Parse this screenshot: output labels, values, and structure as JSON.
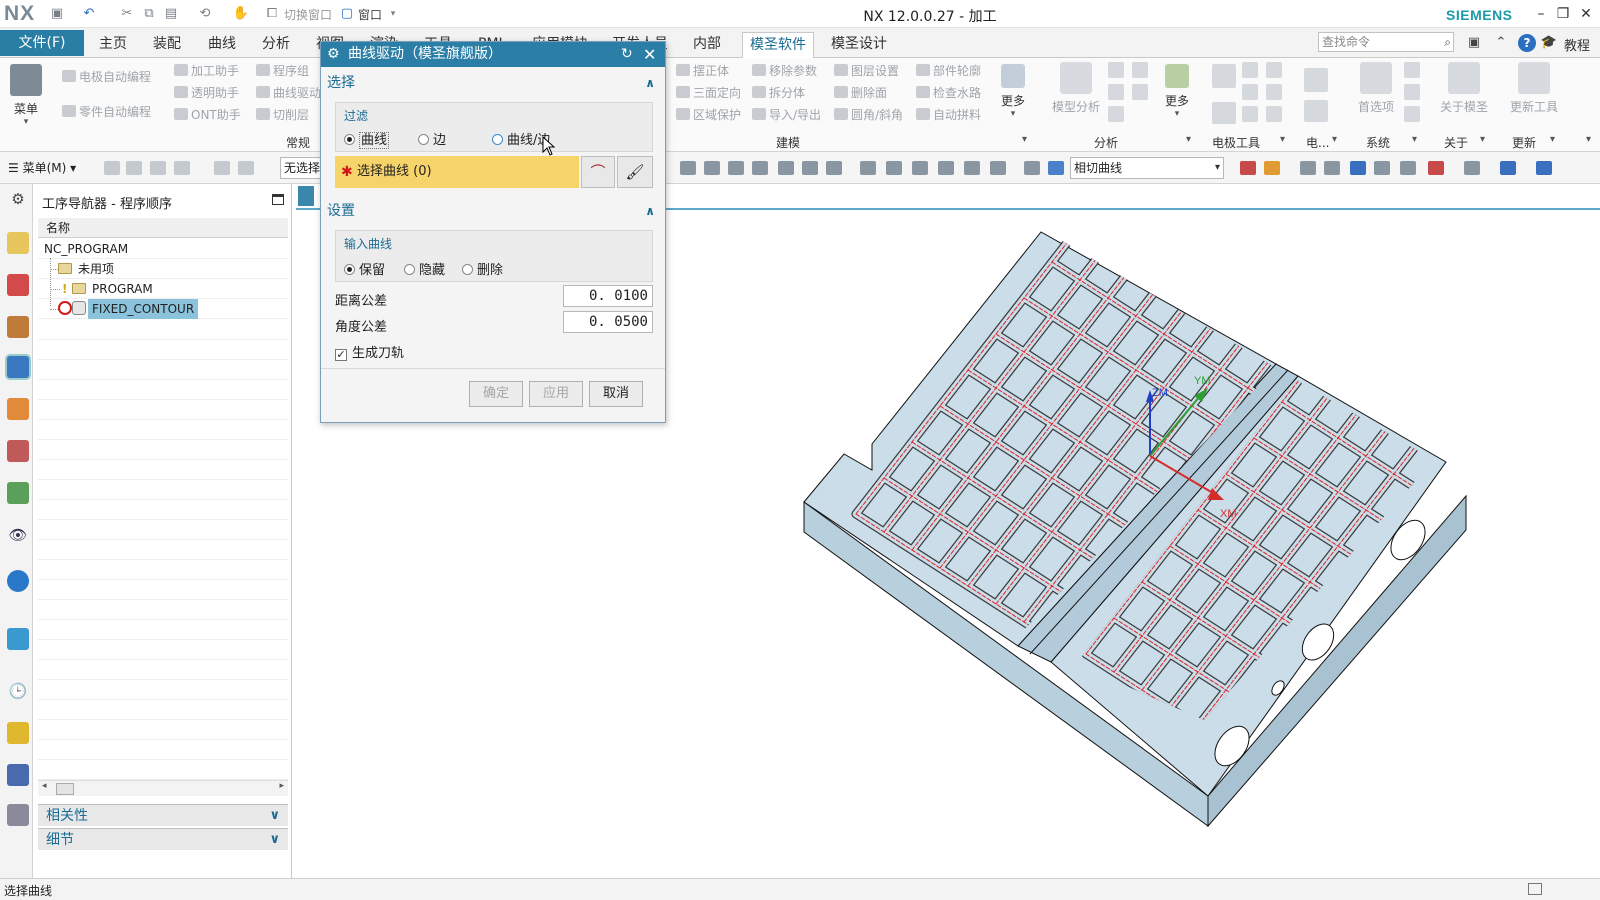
{
  "app": {
    "logo": "NX",
    "title": "NX 12.0.0.27 - 加工",
    "brand": "SIEMENS",
    "quick_access": {
      "switch_window": "切换窗口",
      "window": "窗口"
    }
  },
  "tabs": {
    "file": "文件(F)",
    "items": [
      "主页",
      "装配",
      "曲线",
      "分析",
      "视图",
      "渲染",
      "工具",
      "PMI",
      "应用模块",
      "开发人员",
      "内部",
      "模圣软件",
      "模圣设计"
    ],
    "active": "模圣软件",
    "search_placeholder": "查找命令",
    "tutorial": "教程"
  },
  "ribbon": {
    "menu_label": "菜单",
    "col1": [
      "电极自动编程",
      "零件自动编程"
    ],
    "col2": [
      "加工助手",
      "透明助手",
      "ONT助手"
    ],
    "col3": [
      "程序组",
      "曲线驱动",
      "切削层"
    ],
    "group_general": "常规",
    "col4": [
      "摆正体",
      "三面定向",
      "区域保护"
    ],
    "col5": [
      "移除参数",
      "拆分体",
      "导入/导出"
    ],
    "col6": [
      "图层设置",
      "删除面",
      "圆角/斜角"
    ],
    "col7": [
      "部件轮廓",
      "检查水路",
      "自动拼料"
    ],
    "more1": "更多",
    "group_modeling": "建模",
    "model_analysis": "模型分析",
    "more2": "更多",
    "group_analysis": "分析",
    "group_electrode": "电极工具",
    "group_elec_short": "电...",
    "preferences": "首选项",
    "group_system": "系统",
    "about": "关于模圣",
    "group_about": "关于",
    "update_tool": "更新工具",
    "group_update": "更新"
  },
  "selection_bar": {
    "menu": "菜单(M)",
    "filter": "无选择过滤器",
    "curve_rule": "相切曲线"
  },
  "navigator": {
    "title": "工序导航器 - 程序顺序",
    "column": "名称",
    "rows": [
      {
        "label": "NC_PROGRAM",
        "level": 0
      },
      {
        "label": "未用项",
        "level": 1
      },
      {
        "label": "PROGRAM",
        "level": 1
      },
      {
        "label": "FIXED_CONTOUR",
        "level": 1
      }
    ],
    "selected_row": "FIXED_CONTOUR",
    "accordion": [
      "相关性",
      "细节"
    ]
  },
  "dialog": {
    "title": "曲线驱动（模圣旗舰版）",
    "section_select": "选择",
    "filter_label": "过滤",
    "filter_options": [
      "曲线",
      "边",
      "曲线/边"
    ],
    "filter_selected": "曲线",
    "select_curve": "选择曲线 (0)",
    "section_settings": "设置",
    "input_curve_label": "输入曲线",
    "input_curve_options": [
      "保留",
      "隐藏",
      "删除"
    ],
    "input_curve_selected": "保留",
    "distance_tol_label": "距离公差",
    "distance_tol_value": "0. 0100",
    "angle_tol_label": "角度公差",
    "angle_tol_value": "0. 0500",
    "generate_path_label": "生成刀轨",
    "generate_path_checked": true,
    "buttons": {
      "ok": "确定",
      "apply": "应用",
      "cancel": "取消"
    }
  },
  "viewport": {
    "axes": [
      "ZM",
      "YM",
      "XM"
    ],
    "colors": {
      "part": "#cbdde8",
      "edge": "#111111",
      "toolpath": "#e02020",
      "z_axis": "#1d3fcc",
      "y_axis": "#2d9d35",
      "x_axis": "#d62b2b"
    }
  },
  "status": {
    "text": "选择曲线"
  },
  "colors": {
    "accent": "#2b7fa7",
    "select_highlight": "#f7d46a",
    "nav_selection": "#8cc3dc"
  }
}
